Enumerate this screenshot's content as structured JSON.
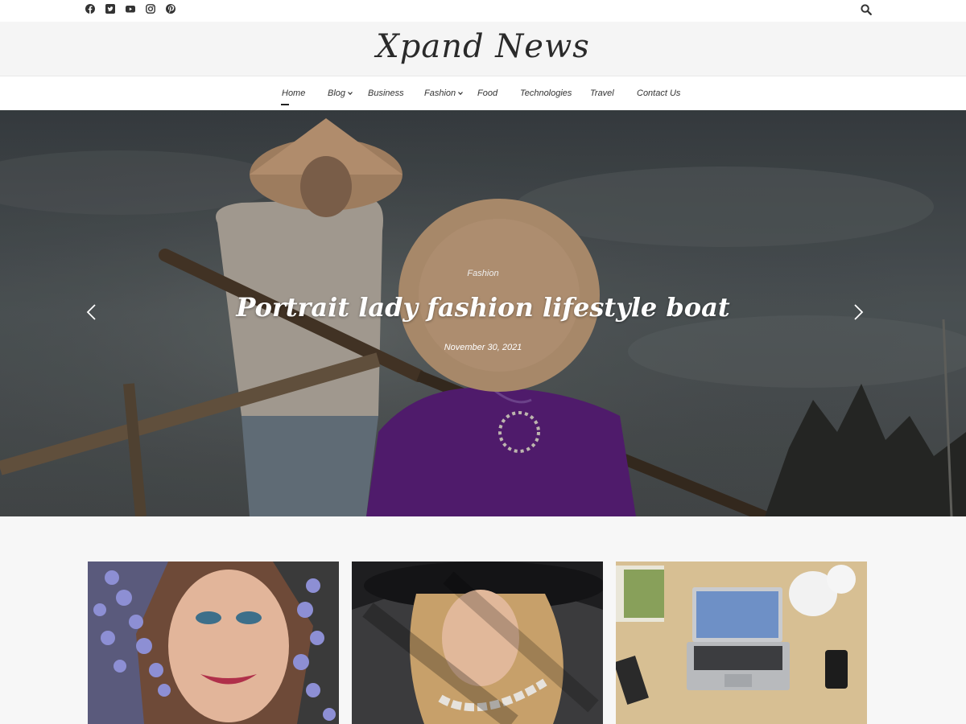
{
  "header": {
    "site_title": "Xpand News",
    "social_icons": [
      "facebook-icon",
      "twitter-icon",
      "youtube-icon",
      "instagram-icon",
      "pinterest-icon"
    ],
    "search_icon": "search-icon"
  },
  "nav": {
    "items": [
      {
        "label": "Home",
        "active": true,
        "has_dropdown": false
      },
      {
        "label": "Blog",
        "active": false,
        "has_dropdown": true
      },
      {
        "label": "Business",
        "active": false,
        "has_dropdown": false
      },
      {
        "label": "Fashion",
        "active": false,
        "has_dropdown": true
      },
      {
        "label": "Food",
        "active": false,
        "has_dropdown": false
      },
      {
        "label": "Technologies",
        "active": false,
        "has_dropdown": false
      },
      {
        "label": "Travel",
        "active": false,
        "has_dropdown": false
      },
      {
        "label": "Contact Us",
        "active": false,
        "has_dropdown": false
      }
    ]
  },
  "slider": {
    "category": "Fashion",
    "title": "Portrait lady fashion lifestyle boat",
    "date": "November 30, 2021",
    "prev_icon": "chevron-left-icon",
    "next_icon": "chevron-right-icon"
  },
  "cards": [
    {
      "image": "woman-with-flowers-photo"
    },
    {
      "image": "woman-in-hat-photo"
    },
    {
      "image": "laptop-desk-photo"
    }
  ],
  "colors": {
    "page_bg": "#f7f7f7",
    "header_bg": "#f5f5f5",
    "text": "#222222",
    "accent_purple": "#5a1f7a"
  }
}
